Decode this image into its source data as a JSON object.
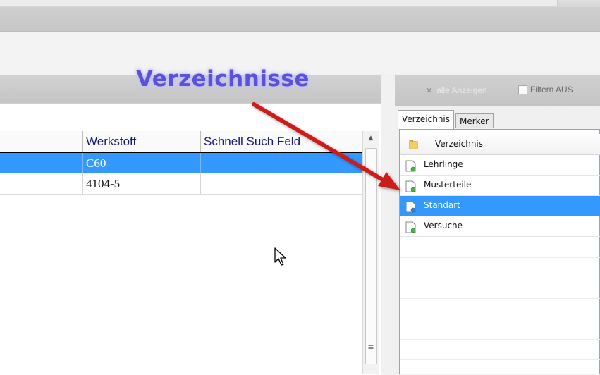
{
  "annotation": {
    "text": "Verzeichnisse",
    "color": "#5b52d8"
  },
  "grid": {
    "columns": [
      "Werkstoff",
      "Schnell Such Feld"
    ],
    "rows": [
      {
        "werkstoff": "C60",
        "schnell": "",
        "selected": true
      },
      {
        "werkstoff": "4104-5",
        "schnell": "",
        "selected": false
      }
    ]
  },
  "right_toolbar": {
    "show_all_label": "alle Anzeigen",
    "filter_label": "Filtern AUS",
    "filter_checked": false
  },
  "tabs": [
    {
      "label": "Verzeichnis",
      "active": true
    },
    {
      "label": "Merker",
      "active": false
    }
  ],
  "tree": {
    "header_label": "Verzeichnis",
    "header_icon": "folder-icon",
    "items": [
      {
        "label": "Lehrlinge",
        "icon": "document-icon",
        "selected": false
      },
      {
        "label": "Musterteile",
        "icon": "document-icon",
        "selected": false
      },
      {
        "label": "Standart",
        "icon": "document-icon",
        "selected": true
      },
      {
        "label": "Versuche",
        "icon": "document-icon",
        "selected": false
      }
    ]
  },
  "colors": {
    "selection": "#3399ff",
    "arrow": "#cc1f1f"
  }
}
